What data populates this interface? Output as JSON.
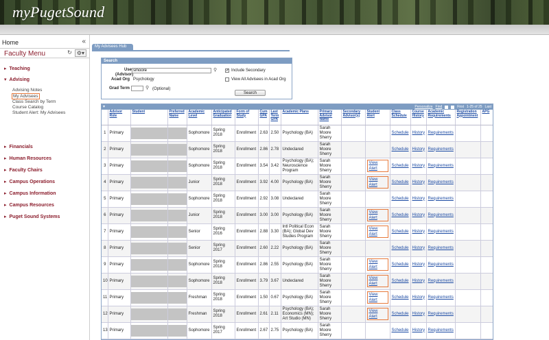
{
  "banner": {
    "logo": "myPugetSound"
  },
  "sidebar": {
    "home": "Home",
    "collapse": "«",
    "menu_title": "Faculty Menu",
    "sections": {
      "teaching": "Teaching",
      "advising": "Advising",
      "financials": "Financials",
      "human_resources": "Human Resources",
      "faculty_chairs": "Faculty Chairs",
      "campus_operations": "Campus Operations",
      "campus_information": "Campus Information",
      "campus_resources": "Campus Resources",
      "puget_sound_systems": "Puget Sound Systems"
    },
    "advising_items": {
      "notes": "Advising Notes",
      "my_advisees": "My Advisees",
      "class_search": "Class Search by Term",
      "course_catalog": "Course Catalog",
      "student_alert": "Student Alert: My Advisees"
    }
  },
  "hub_tab": "My Advisees Hub",
  "search": {
    "title": "Search",
    "user_label": "User\n(Advisor)",
    "user_value": "smoore",
    "acad_org_label": "Acad Org",
    "acad_org_value": "Psychology",
    "grad_term_label": "Grad Term",
    "optional": "(Optional)",
    "include_secondary": "Include Secondary",
    "view_all": "View All Advisees in Acad Org",
    "button": "Search"
  },
  "grid": {
    "personalize": "Personalize",
    "find": "Find",
    "first": "First",
    "range": "1-25 of 25",
    "last": "Last",
    "headers": [
      "",
      "Advisor Role",
      "Student",
      "Preferred Name",
      "Academic Level",
      "Anticipated Graduation",
      "Form of Study",
      "Cum GPA",
      "Last Term GPA",
      "Academic Plans",
      "Primary Advisor Name",
      "Secondary Advisor(s)",
      "Student Alert",
      "Class Schedule",
      "Course History",
      "Academic Requirements",
      "Registration Appointment",
      "APG"
    ],
    "links": {
      "schedule": "Schedule",
      "history": "History",
      "requirements": "Requirements",
      "alert": "View Alert"
    },
    "rows": [
      {
        "n": "1",
        "role": "Primary",
        "level": "Sophomore",
        "grad": "Spring 2018",
        "form": "Enrollment",
        "cum": "2.63",
        "last": "2.50",
        "plans": "Psychology (BA)",
        "adv": "Sarah Moore Sherry",
        "alert": false
      },
      {
        "n": "2",
        "role": "Primary",
        "level": "Sophomore",
        "grad": "Spring 2018",
        "form": "Enrollment",
        "cum": "2.86",
        "last": "2.78",
        "plans": "Undeclared",
        "adv": "Sarah Moore Sherry",
        "alert": false
      },
      {
        "n": "3",
        "role": "Primary",
        "level": "Sophomore",
        "grad": "Spring 2018",
        "form": "Enrollment",
        "cum": "3.54",
        "last": "3.42",
        "plans": "Psychology (BA); Neuroscience Program",
        "adv": "Sarah Moore Sherry",
        "alert": true
      },
      {
        "n": "4",
        "role": "Primary",
        "level": "Junior",
        "grad": "Spring 2018",
        "form": "Enrollment",
        "cum": "3.92",
        "last": "4.00",
        "plans": "Psychology (BA)",
        "adv": "Sarah Moore Sherry",
        "alert": true
      },
      {
        "n": "5",
        "role": "Primary",
        "level": "Sophomore",
        "grad": "Spring 2018",
        "form": "Enrollment",
        "cum": "2.92",
        "last": "3.08",
        "plans": "Undeclared",
        "adv": "Sarah Moore Sherry",
        "alert": false
      },
      {
        "n": "6",
        "role": "Primary",
        "level": "Junior",
        "grad": "Spring 2018",
        "form": "Enrollment",
        "cum": "3.00",
        "last": "3.00",
        "plans": "Psychology (BA)",
        "adv": "Sarah Moore Sherry",
        "alert": true
      },
      {
        "n": "7",
        "role": "Primary",
        "level": "Senior",
        "grad": "Spring 2016",
        "form": "Enrollment",
        "cum": "2.88",
        "last": "3.30",
        "plans": "Intl Political Econ (BA); Global Dev Studies Program",
        "adv": "Sarah Moore Sherry",
        "alert": true
      },
      {
        "n": "8",
        "role": "Primary",
        "level": "Senior",
        "grad": "Spring 2017",
        "form": "Enrollment",
        "cum": "2.60",
        "last": "2.22",
        "plans": "Psychology (BA)",
        "adv": "Sarah Moore Sherry",
        "alert": false
      },
      {
        "n": "9",
        "role": "Primary",
        "level": "Sophomore",
        "grad": "Spring 2018",
        "form": "Enrollment",
        "cum": "2.86",
        "last": "2.55",
        "plans": "Psychology (BA)",
        "adv": "Sarah Moore Sherry",
        "alert": true
      },
      {
        "n": "10",
        "role": "Primary",
        "level": "Sophomore",
        "grad": "Spring 2018",
        "form": "Enrollment",
        "cum": "3.79",
        "last": "3.67",
        "plans": "Undeclared",
        "adv": "Sarah Moore Sherry",
        "alert": true
      },
      {
        "n": "11",
        "role": "Primary",
        "level": "Freshman",
        "grad": "Spring 2018",
        "form": "Enrollment",
        "cum": "1.50",
        "last": "0.67",
        "plans": "Psychology (BA)",
        "adv": "Sarah Moore Sherry",
        "alert": true
      },
      {
        "n": "12",
        "role": "Primary",
        "level": "Freshman",
        "grad": "Spring 2018",
        "form": "Enrollment",
        "cum": "2.61",
        "last": "2.11",
        "plans": "Psychology (BA); Economics (MN); Art Studio (MN)",
        "adv": "Sarah Moore Sherry",
        "alert": true
      },
      {
        "n": "13",
        "role": "Primary",
        "level": "Sophomore",
        "grad": "Spring 2017",
        "form": "Enrollment",
        "cum": "2.67",
        "last": "2.75",
        "plans": "Psychology (BA)",
        "adv": "Sarah Moore Sherry",
        "alert": false
      },
      {
        "n": "",
        "role": "",
        "level": "",
        "grad": "",
        "form": "",
        "cum": "",
        "last": "",
        "plans": "",
        "adv": "Sarah",
        "alert": false
      }
    ]
  }
}
